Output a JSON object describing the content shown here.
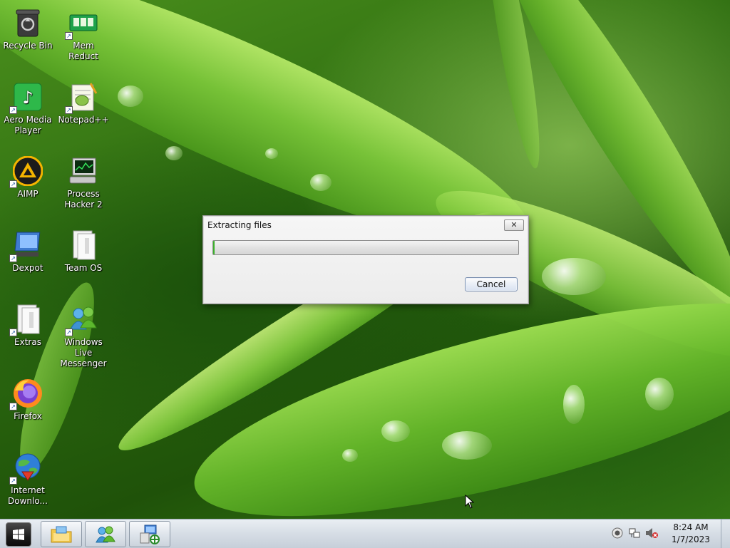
{
  "desktop": {
    "icons": [
      {
        "label": "Recycle Bin",
        "icon": "recycle-bin-icon"
      },
      {
        "label": "Mem Reduct",
        "icon": "mem-reduct-icon"
      },
      {
        "label": "Aero Media Player",
        "icon": "aero-media-player-icon"
      },
      {
        "label": "Notepad++",
        "icon": "notepad-plus-plus-icon"
      },
      {
        "label": "AIMP",
        "icon": "aimp-icon"
      },
      {
        "label": "Process Hacker 2",
        "icon": "process-hacker-icon"
      },
      {
        "label": "Dexpot",
        "icon": "dexpot-icon"
      },
      {
        "label": "Team OS",
        "icon": "folder-icon"
      },
      {
        "label": "Extras",
        "icon": "folder-icon"
      },
      {
        "label": "Windows Live Messenger",
        "icon": "windows-live-messenger-icon"
      },
      {
        "label": "Firefox",
        "icon": "firefox-icon"
      },
      {
        "label": "Internet Downlo...",
        "icon": "internet-download-manager-icon"
      }
    ]
  },
  "dialog": {
    "title": "Extracting files",
    "close_label": "✕",
    "progress": 0.0,
    "cancel_label": "Cancel"
  },
  "taskbar": {
    "start_icon": "windows-logo-icon",
    "pinned": [
      {
        "icon": "explorer-folder-icon"
      },
      {
        "icon": "windows-live-messenger-icon"
      },
      {
        "icon": "network-setup-icon"
      }
    ],
    "tray": [
      {
        "icon": "record-icon"
      },
      {
        "icon": "network-icon"
      },
      {
        "icon": "volume-muted-icon"
      }
    ],
    "time": "8:24 AM",
    "date": "1/7/2023"
  },
  "colors": {
    "progress_fill": "#4fcf3f",
    "taskbar": "#d6dde5",
    "dialog_bg": "#f0f0f0"
  }
}
